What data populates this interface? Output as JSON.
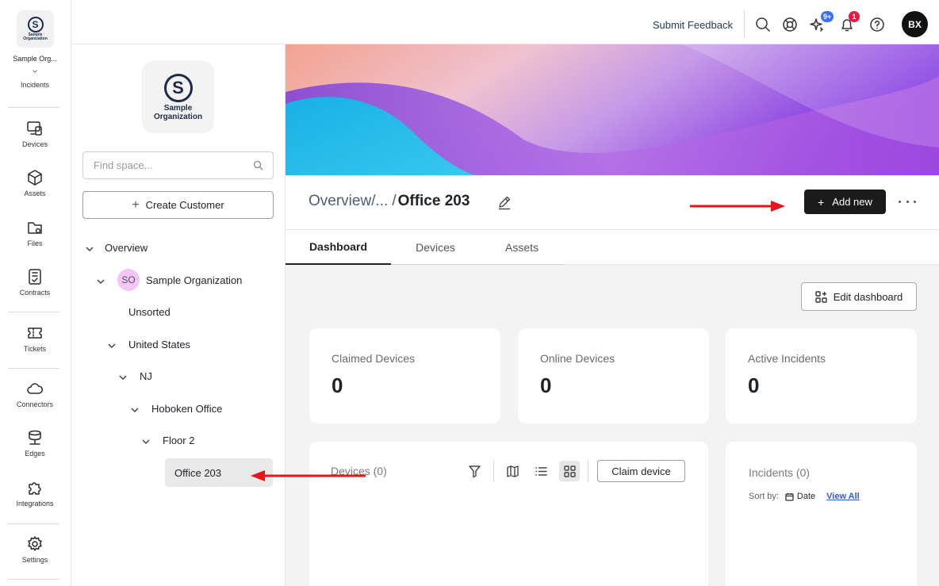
{
  "rail": {
    "org_name": "Sample Org...",
    "org_logo_text": "Sample Organization",
    "org_logo_letter": "S",
    "items": [
      {
        "label": "Incidents",
        "icon": "incidents-icon"
      },
      {
        "label": "Devices",
        "icon": "devices-icon"
      },
      {
        "label": "Assets",
        "icon": "assets-icon"
      },
      {
        "label": "Files",
        "icon": "files-icon"
      },
      {
        "label": "Contracts",
        "icon": "contracts-icon"
      },
      {
        "label": "Tickets",
        "icon": "tickets-icon"
      },
      {
        "label": "Connectors",
        "icon": "cloud-icon"
      },
      {
        "label": "Edges",
        "icon": "edges-icon"
      },
      {
        "label": "Integrations",
        "icon": "puzzle-icon"
      },
      {
        "label": "Settings",
        "icon": "gear-icon"
      }
    ]
  },
  "tree": {
    "logo_letter": "S",
    "logo_line1": "Sample",
    "logo_line2": "Organization",
    "search_placeholder": "Find space...",
    "create_label": "Create Customer",
    "nodes": [
      {
        "label": "Overview",
        "expanded": true
      },
      {
        "label": "Sample Organization",
        "avatar": "SO",
        "expanded": true
      },
      {
        "label": "Unsorted"
      },
      {
        "label": "United States",
        "expanded": true
      },
      {
        "label": "NJ",
        "expanded": true
      },
      {
        "label": "Hoboken Office",
        "expanded": true
      },
      {
        "label": "Floor 2",
        "expanded": true
      },
      {
        "label": "Office 203",
        "selected": true
      }
    ]
  },
  "header": {
    "feedback": "Submit Feedback",
    "ai_badge": "9+",
    "notif_badge": "1",
    "user_initials": "BX"
  },
  "page": {
    "crumb_root": "Overview",
    "crumb_sep1": "/",
    "crumb_ellipsis": "...",
    "crumb_sep2": "/",
    "title": "Office 203",
    "add_new": "Add new",
    "tabs": [
      "Dashboard",
      "Devices",
      "Assets"
    ],
    "active_tab": "Dashboard"
  },
  "dashboard": {
    "edit_label": "Edit dashboard",
    "stats": [
      {
        "label": "Claimed Devices",
        "value": "0"
      },
      {
        "label": "Online Devices",
        "value": "0"
      },
      {
        "label": "Active Incidents",
        "value": "0"
      }
    ],
    "devices_panel": {
      "title": "Devices (0)",
      "claim_label": "Claim device"
    },
    "incidents_panel": {
      "title": "Incidents (0)",
      "sort_label": "Sort by:",
      "sort_value": "Date",
      "view_all": "View All"
    }
  },
  "colors": {
    "annotation_arrow": "#e8161b",
    "badge_blue": "#3b6ff5",
    "badge_red": "#e8173e"
  }
}
